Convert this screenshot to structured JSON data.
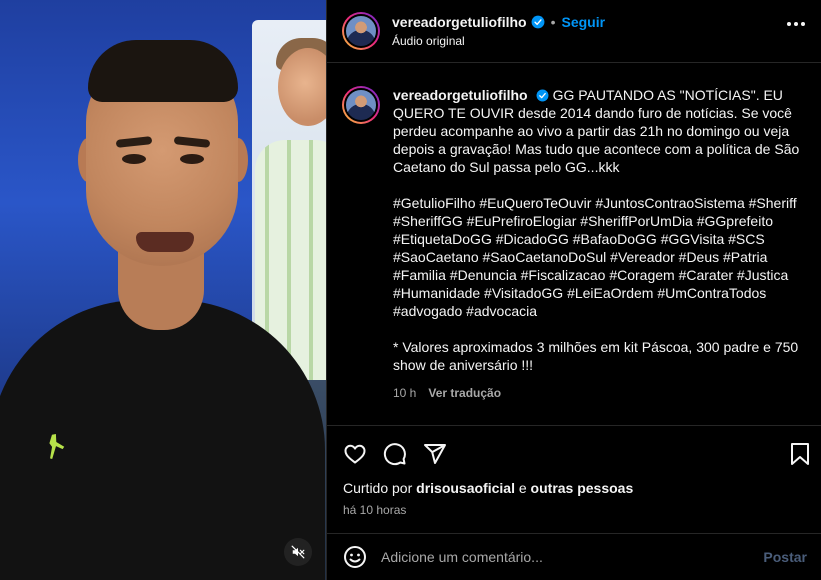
{
  "post": {
    "username": "vereadorgetuliofilho",
    "follow_label": "Seguir",
    "separator": "•",
    "audio_label": "Áudio original"
  },
  "caption": {
    "text": "GG PAUTANDO AS \"NOTÍCIAS\". EU QUERO TE OUVIR desde 2014 dando furo de notícias. Se você perdeu acompanhe ao vivo a partir das 21h no domingo ou veja depois a gravação! Mas tudo que acontece com a política de São Caetano do Sul passa pelo GG...kkk",
    "hashtags": "#GetulioFilho #EuQueroTeOuvir #JuntosContraoSistema #Sheriff #SheriffGG #EuPrefiroElogiar #SheriffPorUmDia #GGprefeito #EtiquetaDoGG #DicadoGG #BafaoDoGG #GGVisita #SCS #SaoCaetano #SaoCaetanoDoSul #Vereador #Deus #Patria #Familia #Denuncia #Fiscalizacao #Coragem #Carater #Justica #Humanidade #VisitadoGG #LeiEaOrdem #UmContraTodos #advogado #advocacia",
    "note": "* Valores aproximados 3 milhões em kit Páscoa, 300 padre e 750 show de aniversário !!!",
    "time_ago": "10 h",
    "translate_label": "Ver tradução"
  },
  "likes": {
    "prefix": "Curtido por",
    "user": "drisousaoficial",
    "connector": "e",
    "others": "outras pessoas"
  },
  "timestamp": "há 10 horas",
  "comment": {
    "placeholder": "Adicione um comentário...",
    "post_label": "Postar"
  },
  "colors": {
    "accent": "#0095f6",
    "post_disabled": "#4a5d7a",
    "muted_text": "#a8a8a8"
  },
  "icons": [
    "verified-badge-icon",
    "more-options-icon",
    "heart-icon",
    "comment-icon",
    "share-icon",
    "bookmark-icon",
    "emoji-icon",
    "muted-speaker-icon"
  ]
}
